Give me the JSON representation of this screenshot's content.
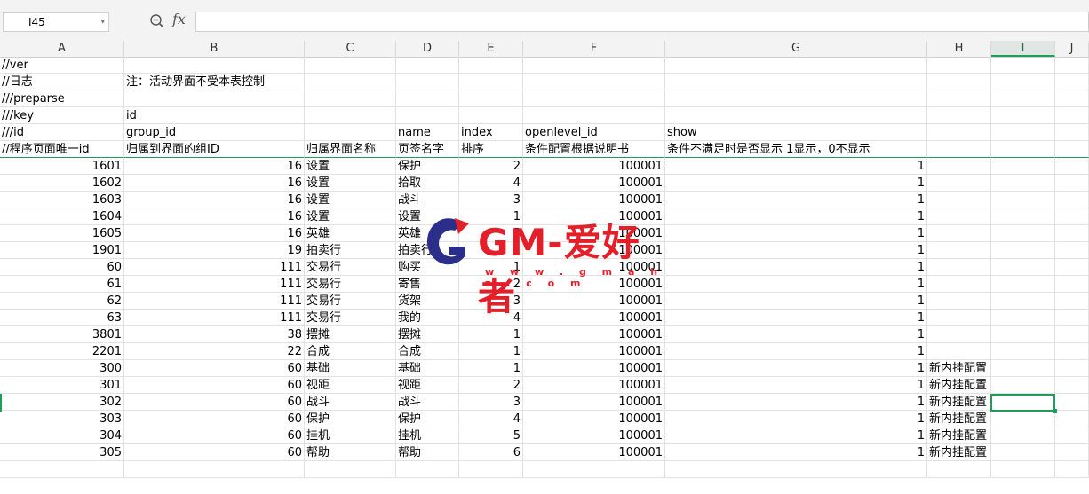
{
  "name_box": {
    "value": "I45"
  },
  "formula": {
    "fx_label": "fx",
    "value": ""
  },
  "columns": [
    "A",
    "B",
    "C",
    "D",
    "E",
    "F",
    "G",
    "H",
    "I",
    "J"
  ],
  "rows": [
    [
      "//ver",
      "",
      "",
      "",
      "",
      "",
      "",
      "",
      ""
    ],
    [
      "//日志",
      "注：活动界面不受本表控制",
      "",
      "",
      "",
      "",
      "",
      "",
      ""
    ],
    [
      "///preparse",
      "",
      "",
      "",
      "",
      "",
      "",
      "",
      ""
    ],
    [
      "///key",
      "id",
      "",
      "",
      "",
      "",
      "",
      "",
      ""
    ],
    [
      "///id",
      "group_id",
      "",
      "name",
      "index",
      "openlevel_id",
      "show",
      "",
      ""
    ],
    [
      "//程序页面唯一id",
      "归属到界面的组ID",
      "归属界面名称",
      "页签名字",
      "排序",
      "条件配置根据说明书",
      "条件不满足时是否显示 1显示，0不显示",
      "",
      ""
    ],
    [
      "1601",
      "16",
      "设置",
      "保护",
      "2",
      "100001",
      "1",
      "",
      ""
    ],
    [
      "1602",
      "16",
      "设置",
      "拾取",
      "4",
      "100001",
      "1",
      "",
      ""
    ],
    [
      "1603",
      "16",
      "设置",
      "战斗",
      "3",
      "100001",
      "1",
      "",
      ""
    ],
    [
      "1604",
      "16",
      "设置",
      "设置",
      "1",
      "100001",
      "1",
      "",
      ""
    ],
    [
      "1605",
      "16",
      "英雄",
      "英雄",
      "5",
      "100001",
      "1",
      "",
      ""
    ],
    [
      "1901",
      "19",
      "拍卖行",
      "拍卖行",
      "1",
      "100001",
      "1",
      "",
      ""
    ],
    [
      "60",
      "111",
      "交易行",
      "购买",
      "1",
      "100001",
      "1",
      "",
      ""
    ],
    [
      "61",
      "111",
      "交易行",
      "寄售",
      "2",
      "100001",
      "1",
      "",
      ""
    ],
    [
      "62",
      "111",
      "交易行",
      "货架",
      "3",
      "100001",
      "1",
      "",
      ""
    ],
    [
      "63",
      "111",
      "交易行",
      "我的",
      "4",
      "100001",
      "1",
      "",
      ""
    ],
    [
      "3801",
      "38",
      "摆摊",
      "摆摊",
      "1",
      "100001",
      "1",
      "",
      ""
    ],
    [
      "2201",
      "22",
      "合成",
      "合成",
      "1",
      "100001",
      "1",
      "",
      ""
    ],
    [
      "300",
      "60",
      "基础",
      "基础",
      "1",
      "100001",
      "1",
      "新内挂配置",
      ""
    ],
    [
      "301",
      "60",
      "视距",
      "视距",
      "2",
      "100001",
      "1",
      "新内挂配置",
      ""
    ],
    [
      "302",
      "60",
      "战斗",
      "战斗",
      "3",
      "100001",
      "1",
      "新内挂配置",
      ""
    ],
    [
      "303",
      "60",
      "保护",
      "保护",
      "4",
      "100001",
      "1",
      "新内挂配置",
      ""
    ],
    [
      "304",
      "60",
      "挂机",
      "挂机",
      "5",
      "100001",
      "1",
      "新内挂配置",
      ""
    ],
    [
      "305",
      "60",
      "帮助",
      "帮助",
      "6",
      "100001",
      "1",
      "新内挂配置",
      ""
    ],
    [
      "",
      "",
      "",
      "",
      "",
      "",
      "",
      "",
      ""
    ]
  ],
  "watermark": {
    "text": "GM-爱好者",
    "url": "w w w . g m a h z . c o m",
    "color": "#e3202a"
  }
}
